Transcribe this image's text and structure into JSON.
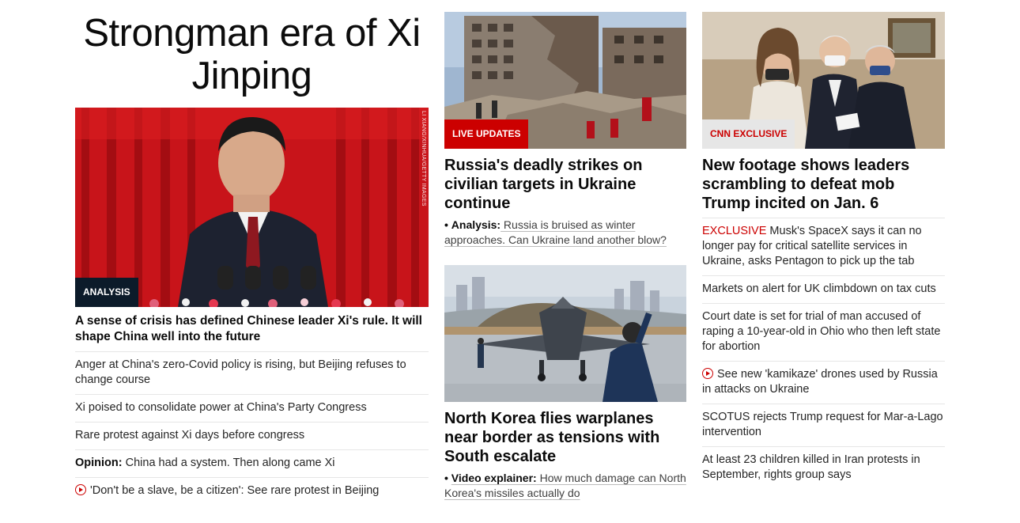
{
  "col1": {
    "title": "Strongman era of Xi Jinping",
    "image": {
      "credit": "LI XIANG/XINHUA/GETTY IMAGES",
      "tag": "ANALYSIS"
    },
    "headline": "A sense of crisis has defined Chinese leader Xi's rule. It will shape China well into the future",
    "items": [
      {
        "text": "Anger at China's zero-Covid policy is rising, but Beijing refuses to change course"
      },
      {
        "text": "Xi poised to consolidate power at China's Party Congress"
      },
      {
        "text": "Rare protest against Xi days before congress"
      },
      {
        "prefix": "Opinion:",
        "text": " China had a system. Then along came Xi"
      },
      {
        "text": "'Don't be a slave, be a citizen': See rare protest in Beijing",
        "icon": "play-icon"
      }
    ]
  },
  "col2": {
    "story1": {
      "tag": "LIVE UPDATES",
      "headline": "Russia's deadly strikes on civilian targets in Ukraine continue",
      "sub_bullet": "•",
      "sub_label": "Analysis:",
      "sub_text": " Russia is bruised as winter approaches. Can Ukraine land another blow?"
    },
    "story2": {
      "headline": "North Korea flies warplanes near border as tensions with South escalate",
      "sub_bullet": "•",
      "sub_label": "Video explainer:",
      "sub_text": " How much damage can North Korea's missiles actually do"
    }
  },
  "col3": {
    "tag": "CNN EXCLUSIVE",
    "headline": "New footage shows leaders scrambling to defeat mob Trump incited on Jan. 6",
    "items": [
      {
        "excl": "EXCLUSIVE",
        "text": " Musk's SpaceX says it can no longer pay for critical satellite services in Ukraine, asks Pentagon to pick up the tab"
      },
      {
        "text": "Markets on alert for UK climbdown on tax cuts"
      },
      {
        "text": "Court date is set for trial of man accused of raping a 10-year-old in Ohio who then left state for abortion"
      },
      {
        "text": "See new 'kamikaze' drones used by Russia in attacks on Ukraine",
        "icon": "play-icon"
      },
      {
        "text": "SCOTUS rejects Trump request for Mar-a-Lago intervention"
      },
      {
        "text": "At least 23 children killed in Iran protests in September, rights group says"
      }
    ]
  },
  "colors": {
    "accent_red": "#cc0000",
    "analysis_bg": "#0c1b2a",
    "divider": "#e6e6e6"
  }
}
